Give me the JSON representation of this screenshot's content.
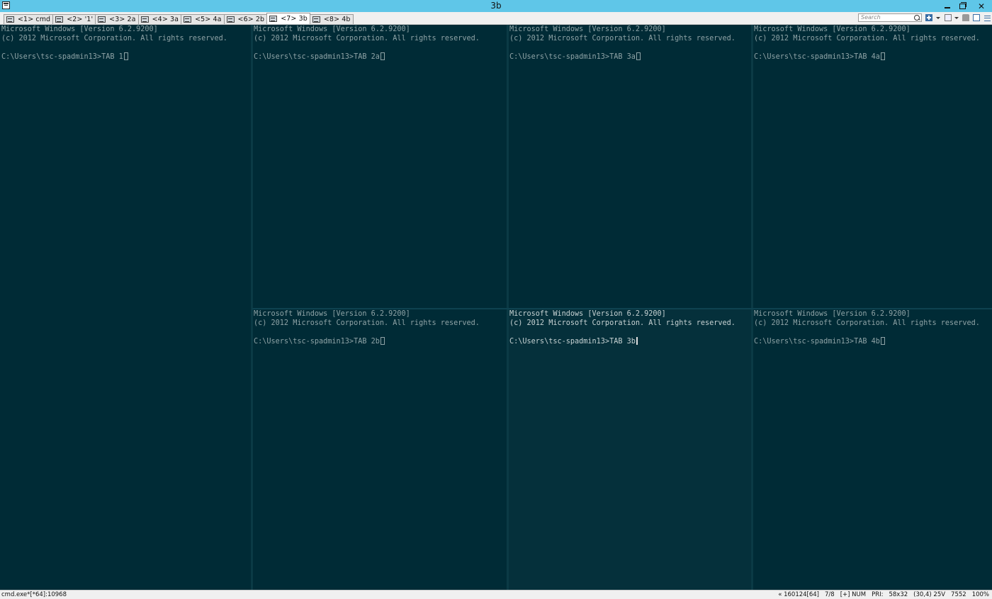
{
  "window": {
    "title": "3b",
    "minimize_label": "",
    "close_label": "✕"
  },
  "tabs": [
    {
      "label": "<1> cmd"
    },
    {
      "label": "<2> '1'"
    },
    {
      "label": "<3> 2a"
    },
    {
      "label": "<4> 3a"
    },
    {
      "label": "<5> 4a"
    },
    {
      "label": "<6> 2b"
    },
    {
      "label": "<7> 3b",
      "active": true
    },
    {
      "label": "<8> 4b"
    }
  ],
  "toolbar": {
    "search_placeholder": "Search"
  },
  "console": {
    "line1": "Microsoft Windows [Version 6.2.9200]",
    "line2": "(c) 2012 Microsoft Corporation. All rights reserved.",
    "prompt": "C:\\Users\\tsc-spadmin13>"
  },
  "panes": [
    {
      "id": "1",
      "command": "TAB 1"
    },
    {
      "id": "2a",
      "command": "TAB 2a"
    },
    {
      "id": "3a",
      "command": "TAB 3a"
    },
    {
      "id": "4a",
      "command": "TAB 4a"
    },
    {
      "id": "2b",
      "command": "TAB 2b"
    },
    {
      "id": "3b",
      "command": "TAB 3b",
      "active": true
    },
    {
      "id": "4b",
      "command": "TAB 4b"
    }
  ],
  "statusbar": {
    "process": "cmd.exe*[*64]:10968",
    "items": [
      "« 160124[64]",
      "7/8",
      "[+] NUM",
      "PRI:",
      "58x32",
      "(30,4) 25V",
      "7552",
      "100%"
    ]
  }
}
